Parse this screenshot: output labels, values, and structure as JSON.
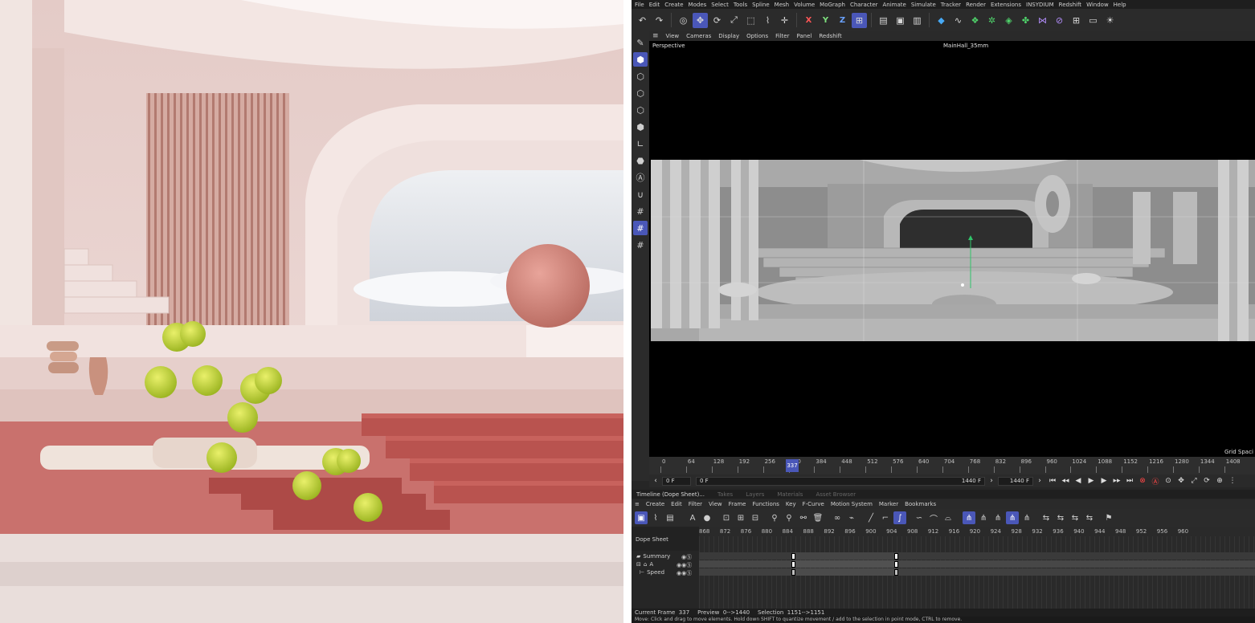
{
  "menubar": [
    "File",
    "Edit",
    "Create",
    "Modes",
    "Select",
    "Tools",
    "Spline",
    "Mesh",
    "Volume",
    "MoGraph",
    "Character",
    "Animate",
    "Simulate",
    "Tracker",
    "Render",
    "Extensions",
    "INSYDIUM",
    "Redshift",
    "Window",
    "Help"
  ],
  "viewport_menu": [
    "View",
    "Cameras",
    "Display",
    "Options",
    "Filter",
    "Panel",
    "Redshift"
  ],
  "viewport": {
    "mode_label": "Perspective",
    "camera_label": "MainHall_35mm",
    "grid_label": "Grid Spaci"
  },
  "ruler": {
    "ticks": [
      "0",
      "64",
      "128",
      "192",
      "256",
      "320",
      "384",
      "448",
      "512",
      "576",
      "640",
      "704",
      "768",
      "832",
      "896",
      "960",
      "1024",
      "1088",
      "1152",
      "1216",
      "1280",
      "1344",
      "1408"
    ],
    "playhead": "337"
  },
  "playbar": {
    "start": "0 F",
    "current": "0 F",
    "end": "1440 F",
    "end2": "1440 F"
  },
  "tabs": [
    {
      "label": "Timeline (Dope Sheet)...",
      "active": true
    },
    {
      "label": "Takes",
      "active": false
    },
    {
      "label": "Layers",
      "active": false
    },
    {
      "label": "Materials",
      "active": false
    },
    {
      "label": "Asset Browser",
      "active": false
    }
  ],
  "timeline_menu": [
    "Create",
    "Edit",
    "Filter",
    "View",
    "Frame",
    "Functions",
    "Key",
    "F-Curve",
    "Motion System",
    "Marker",
    "Bookmarks"
  ],
  "dope_sheet": {
    "title": "Dope Sheet",
    "frames": [
      "868",
      "872",
      "876",
      "880",
      "884",
      "888",
      "892",
      "896",
      "900",
      "904",
      "908",
      "912",
      "916",
      "920",
      "924",
      "928",
      "932",
      "936",
      "940",
      "944",
      "948",
      "952",
      "956",
      "960"
    ],
    "tracks": [
      "Summary",
      "A",
      "Speed"
    ]
  },
  "status": {
    "current_frame_label": "Current Frame",
    "current_frame": "337",
    "preview_label": "Preview",
    "preview": "0-->1440",
    "selection_label": "Selection",
    "selection": "1151-->1151"
  },
  "help_text": "Move: Click and drag to move elements. Hold down SHIFT to quantize movement / add to the selection in point mode, CTRL to remove."
}
